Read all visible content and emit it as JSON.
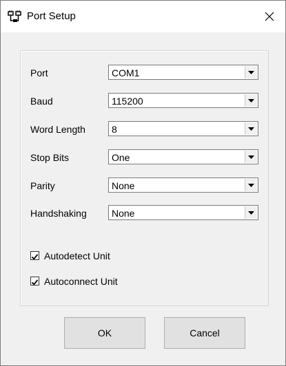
{
  "window": {
    "title": "Port Setup"
  },
  "icons": {
    "app": "port-setup-app-icon",
    "close": "close-icon",
    "dropdown": "chevron-down-icon",
    "check": "checkmark-icon"
  },
  "fields": [
    {
      "label": "Port",
      "value": "COM1"
    },
    {
      "label": "Baud",
      "value": "115200"
    },
    {
      "label": "Word Length",
      "value": "8"
    },
    {
      "label": "Stop Bits",
      "value": "One"
    },
    {
      "label": "Parity",
      "value": "None"
    },
    {
      "label": "Handshaking",
      "value": "None"
    }
  ],
  "checkboxes": [
    {
      "label": "Autodetect Unit",
      "checked": true
    },
    {
      "label": "Autoconnect Unit",
      "checked": true
    }
  ],
  "buttons": {
    "ok": "OK",
    "cancel": "Cancel"
  }
}
